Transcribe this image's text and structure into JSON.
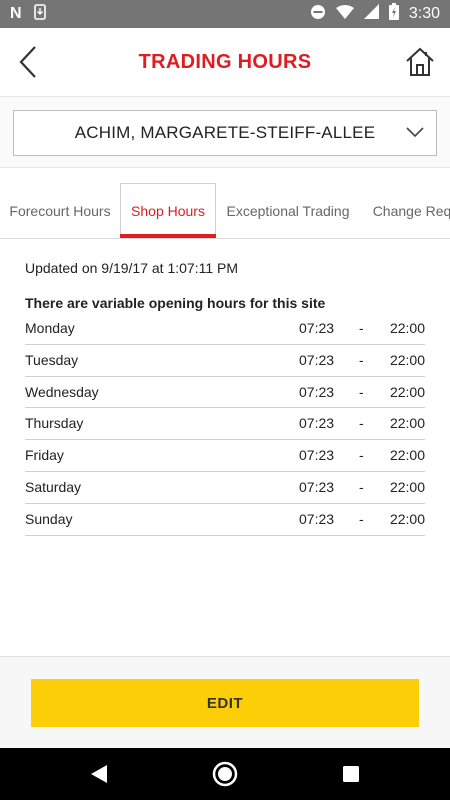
{
  "status_bar": {
    "time": "3:30",
    "notification_letter": "N",
    "icons": [
      "notification-n-icon",
      "phone-icon",
      "do-not-disturb-icon",
      "wifi-icon",
      "signal-icon",
      "battery-charging-icon"
    ]
  },
  "header": {
    "title": "TRADING HOURS",
    "back_icon": "back-chevron-icon",
    "home_icon": "home-icon"
  },
  "site_selector": {
    "selected_site": "ACHIM, MARGARETE-STEIFF-ALLEE",
    "icon": "chevron-down-icon"
  },
  "tabs": [
    {
      "label": "Forecourt Hours",
      "active": false
    },
    {
      "label": "Shop Hours",
      "active": true
    },
    {
      "label": "Exceptional Trading",
      "active": false
    },
    {
      "label": "Change Req",
      "active": false
    }
  ],
  "content": {
    "updated": "Updated on 9/19/17 at 1:07:11 PM",
    "notice": "There are variable opening hours for this site",
    "hours": [
      {
        "day": "Monday",
        "open": "07:23",
        "sep": "-",
        "close": "22:00"
      },
      {
        "day": "Tuesday",
        "open": "07:23",
        "sep": "-",
        "close": "22:00"
      },
      {
        "day": "Wednesday",
        "open": "07:23",
        "sep": "-",
        "close": "22:00"
      },
      {
        "day": "Thursday",
        "open": "07:23",
        "sep": "-",
        "close": "22:00"
      },
      {
        "day": "Friday",
        "open": "07:23",
        "sep": "-",
        "close": "22:00"
      },
      {
        "day": "Saturday",
        "open": "07:23",
        "sep": "-",
        "close": "22:00"
      },
      {
        "day": "Sunday",
        "open": "07:23",
        "sep": "-",
        "close": "22:00"
      }
    ]
  },
  "footer": {
    "edit_label": "EDIT"
  },
  "nav_bar": {
    "icons": [
      "nav-back-icon",
      "nav-home-icon",
      "nav-recents-icon"
    ]
  },
  "colors": {
    "brand_red": "#dd1d21",
    "brand_yellow": "#fbce07",
    "status_bar": "#757575",
    "nav_bar": "#000000"
  }
}
